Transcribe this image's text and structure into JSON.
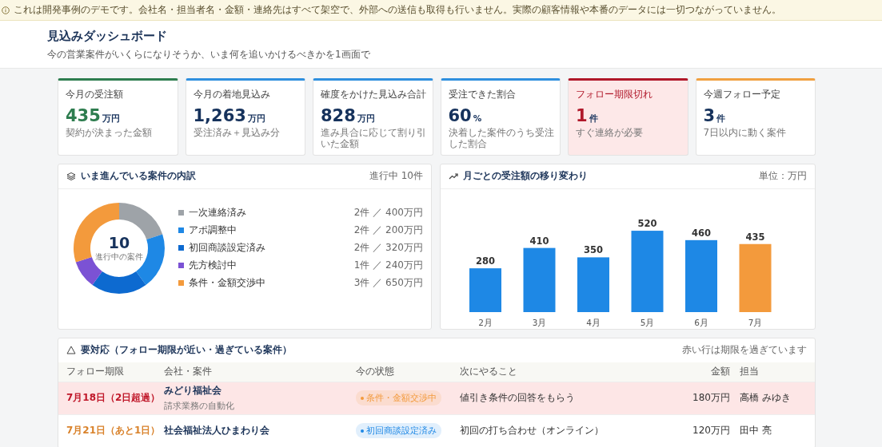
{
  "notice": "これは開発事例のデモです。会社名・担当者名・金額・連絡先はすべて架空で、外部への送信も取得も行いません。実際の顧客情報や本番のデータには一切つながっていません。",
  "header": {
    "title": "見込みダッシュボード",
    "subtitle": "今の営業案件がいくらになりそうか、いま何を追いかけるべきかを1画面で"
  },
  "cards": [
    {
      "label": "今月の受注額",
      "value": "435",
      "unit": "万円",
      "note": "契約が決まった金額",
      "color": "#2e7d4f",
      "highlight": true,
      "alert": false
    },
    {
      "label": "今月の着地見込み",
      "value": "1,263",
      "unit": "万円",
      "note": "受注済み＋見込み分",
      "color": "#2f8fde",
      "highlight": false,
      "alert": false
    },
    {
      "label": "確度をかけた見込み合計",
      "value": "828",
      "unit": "万円",
      "note": "進み具合に応じて割り引いた金額",
      "color": "#2f8fde",
      "highlight": false,
      "alert": false
    },
    {
      "label": "受注できた割合",
      "value": "60",
      "unit": "%",
      "note": "決着した案件のうち受注した割合",
      "color": "#2f8fde",
      "highlight": false,
      "alert": false
    },
    {
      "label": "フォロー期限切れ",
      "value": "1",
      "unit": "件",
      "note": "すぐ連絡が必要",
      "color": "#b0182a",
      "highlight": true,
      "alert": true
    },
    {
      "label": "今週フォロー予定",
      "value": "3",
      "unit": "件",
      "note": "7日以内に動く案件",
      "color": "#f0a040",
      "highlight": false,
      "alert": false
    }
  ],
  "pipeline": {
    "title": "いま進んでいる案件の内訳",
    "count": "進行中 10件",
    "center_value": "10",
    "center_label": "進行中の案件",
    "chart_data": {
      "type": "donut",
      "categories": [
        "一次連絡済み",
        "アポ調整中",
        "初回商談設定済み",
        "先方検討中",
        "条件・金額交渉中"
      ],
      "values": [
        20,
        20,
        20,
        10,
        30
      ]
    },
    "legend": [
      {
        "detail": "2件 ／ 400万円",
        "color": "#9ea3a8"
      },
      {
        "detail": "2件 ／ 200万円",
        "color": "#1e88e5"
      },
      {
        "detail": "2件 ／ 320万円",
        "color": "#0d6ad0"
      },
      {
        "detail": "1件 ／ 240万円",
        "color": "#7b52d4"
      },
      {
        "detail": "3件 ／ 650万円",
        "color": "#f39a3c"
      }
    ]
  },
  "monthly": {
    "title": "月ごとの受注額の移り変わり",
    "unit": "単位：万円",
    "chart_data": {
      "type": "bar",
      "categories": [
        "2月",
        "3月",
        "4月",
        "5月",
        "6月",
        "7月"
      ],
      "values": [
        280,
        410,
        350,
        520,
        460,
        435
      ],
      "data_labels": true
    },
    "bars": [
      {
        "color": "#1e88e5"
      },
      {
        "color": "#1e88e5"
      },
      {
        "color": "#1e88e5"
      },
      {
        "color": "#1e88e5"
      },
      {
        "color": "#1e88e5"
      },
      {
        "color": "#f39a3c"
      }
    ]
  },
  "followups": {
    "title": "要対応（フォロー期限が近い・過ぎている案件）",
    "note": "赤い行は期限を過ぎています",
    "columns": [
      "フォロー期限",
      "会社・案件",
      "今の状態",
      "次にやること",
      "金額",
      "担当"
    ],
    "rows": [
      {
        "due": "7月18日（2日超過）",
        "company": "みどり福祉会",
        "project": "請求業務の自動化",
        "status": "条件・金額交渉中",
        "color": "#f39a3c",
        "next": "値引き条件の回答をもらう",
        "amount": "180万円",
        "owner": "高橋 みゆき",
        "overdue": true
      },
      {
        "due": "7月21日（あと1日）",
        "company": "社会福祉法人ひまわり会",
        "status": "初回商談設定済み",
        "color": "#1e88e5",
        "next": "初回の打ち合わせ（オンライン）",
        "amount": "120万円",
        "owner": "田中 亮",
        "overdue": false
      }
    ]
  }
}
